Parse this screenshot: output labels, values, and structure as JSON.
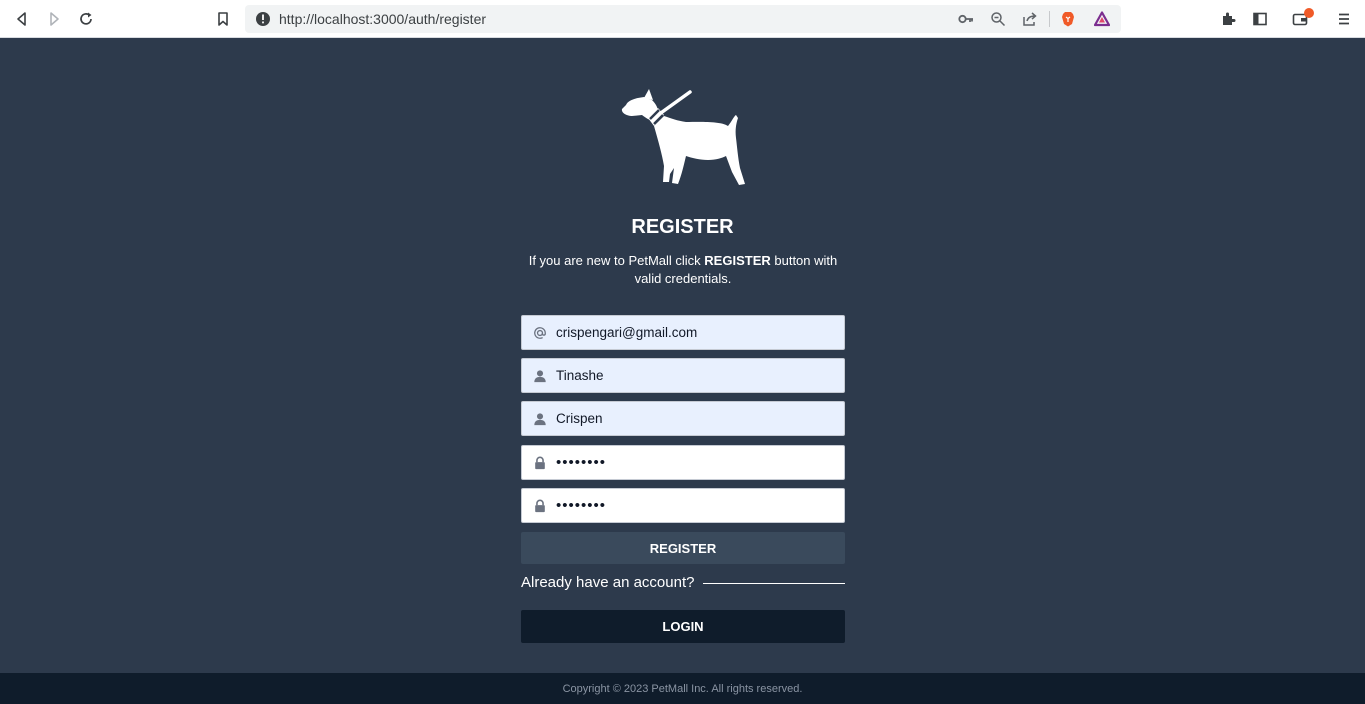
{
  "browser": {
    "url": "http://localhost:3000/auth/register",
    "icons": [
      "back-icon",
      "forward-icon",
      "reload-icon",
      "bookmark-icon",
      "info-icon",
      "key-icon",
      "zoom-icon",
      "share-icon",
      "brave-shield-icon",
      "brave-rewards-icon",
      "extensions-icon",
      "sidebar-icon",
      "wallet-icon",
      "menu-icon"
    ]
  },
  "page": {
    "title": "REGISTER",
    "subtitle_before": "If you are new to PetMall click ",
    "subtitle_bold": "REGISTER",
    "subtitle_after": " button with valid credentials."
  },
  "form": {
    "email": {
      "icon": "at-icon",
      "value": "crispengari@gmail.com"
    },
    "first_name": {
      "icon": "user-icon",
      "value": "Tinashe"
    },
    "last_name": {
      "icon": "user-icon",
      "value": "Crispen"
    },
    "password": {
      "icon": "lock-icon",
      "value": "••••••••"
    },
    "confirm_password": {
      "icon": "lock-icon",
      "value": "••••••••"
    },
    "register_label": "REGISTER",
    "already_text": "Already have an account?",
    "login_label": "LOGIN"
  },
  "footer": {
    "copyright": "Copyright © 2023 PetMall Inc. All rights reserved."
  },
  "colors": {
    "page_bg": "#2d3a4c",
    "footer_bg": "#0f1c2b",
    "register_btn": "#3a4a5c",
    "login_btn": "#0f1c2b",
    "autofill_bg": "#e8f0fe",
    "brave_orange": "#f05a28"
  }
}
